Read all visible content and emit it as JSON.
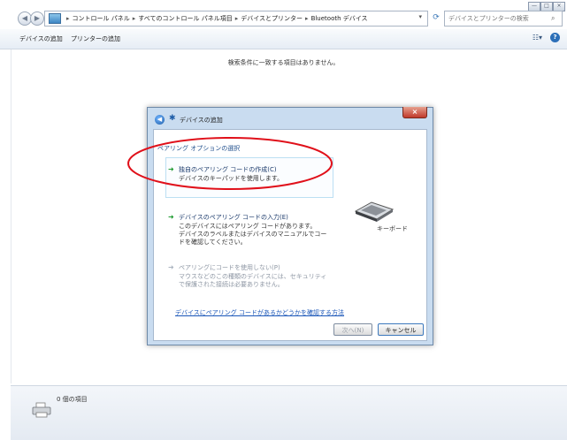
{
  "window": {
    "breadcrumbs": [
      "コントロール パネル",
      "すべてのコントロール パネル項目",
      "デバイスとプリンター",
      "Bluetooth デバイス"
    ],
    "search_placeholder": "デバイスとプリンターの検索",
    "controls": [
      "—",
      "□",
      "×"
    ]
  },
  "command_bar": {
    "add_device": "デバイスの追加",
    "add_printer": "プリンターの追加"
  },
  "content": {
    "empty_message": "検索条件に一致する項目はありません。"
  },
  "status_bar": {
    "item_count": "0 個の項目"
  },
  "dialog": {
    "title": "デバイスの追加",
    "section_heading": "ペアリング オプションの選択",
    "options": [
      {
        "title": "独自のペアリング コードの作成(C)",
        "desc": [
          "デバイスのキーパッドを使用します。"
        ],
        "enabled": true
      },
      {
        "title": "デバイスのペアリング コードの入力(E)",
        "desc": [
          "このデバイスにはペアリング コードがあります。",
          "デバイスのラベルまたはデバイスのマニュアルでコー",
          "ドを確認してください。"
        ],
        "enabled": true
      },
      {
        "title": "ペアリングにコードを使用しない(P)",
        "desc": [
          "マウスなどのこの種類のデバイスには、セキュリティ",
          "で保護された接続は必要ありません。"
        ],
        "enabled": false
      }
    ],
    "device_label": "キーボード",
    "help_link": "デバイスにペアリング コードがあるかどうかを確認する方法",
    "next_button": "次へ(N)",
    "cancel_button": "キャンセル"
  },
  "colors": {
    "annotation": "#e0101a",
    "option_arrow": "#1c9a2e",
    "link": "#1a56b8"
  }
}
